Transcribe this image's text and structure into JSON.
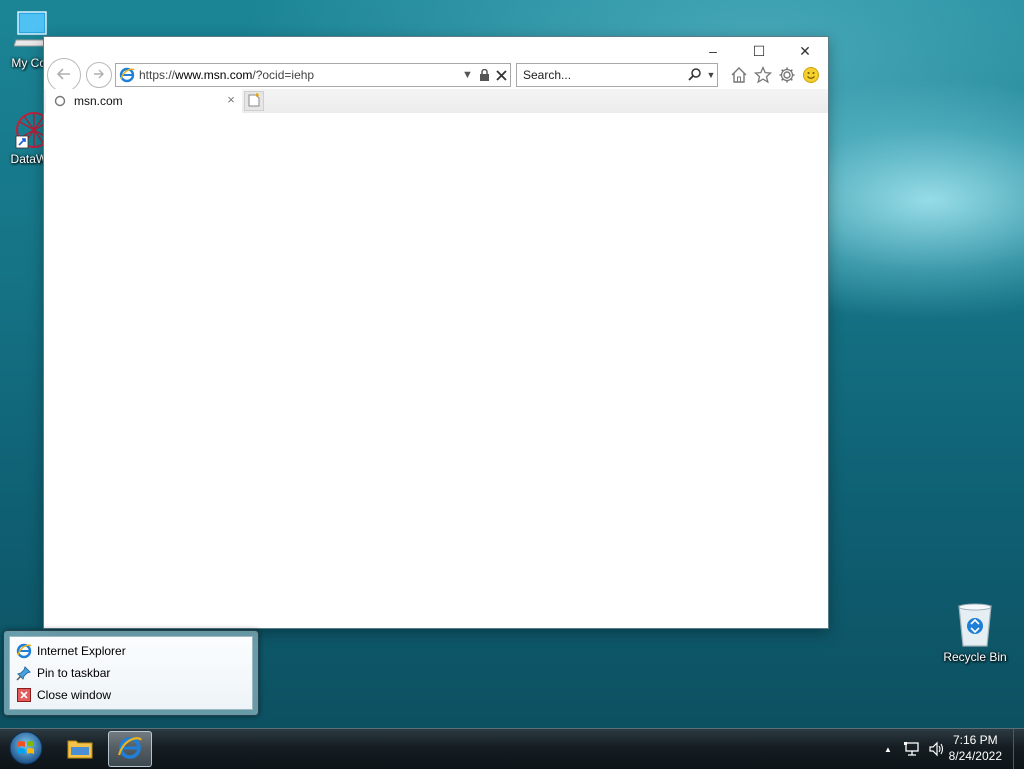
{
  "desktop": {
    "icons": [
      {
        "label": "My Con",
        "icon": "computer-icon"
      },
      {
        "label": "DataWa",
        "icon": "datawarrior-icon"
      },
      {
        "label": "Recycle Bin",
        "icon": "recycle-bin-icon"
      }
    ]
  },
  "browser": {
    "window_controls": {
      "minimize": "–",
      "maximize": "☐",
      "close": "✕"
    },
    "address": {
      "prefix": "https://",
      "domain": "www.msn.com",
      "path": "/?ocid=iehp"
    },
    "search": {
      "placeholder": "Search..."
    },
    "tab": {
      "title": "msn.com",
      "close": "×"
    },
    "toolbar_icons": [
      "home-icon",
      "favorites-star-icon",
      "tools-gear-icon",
      "feedback-smiley-icon"
    ]
  },
  "jump_list": {
    "items": [
      {
        "label": "Internet Explorer",
        "icon": "internet-explorer-icon"
      },
      {
        "label": "Pin to taskbar",
        "icon": "pin-icon"
      },
      {
        "label": "Close window",
        "icon": "close-window-icon"
      }
    ]
  },
  "taskbar": {
    "buttons": [
      "start-orb-icon",
      "file-explorer-icon",
      "internet-explorer-icon"
    ],
    "tray": {
      "expand": "▲"
    },
    "clock": {
      "time": "7:16 PM",
      "date": "8/24/2022"
    }
  }
}
